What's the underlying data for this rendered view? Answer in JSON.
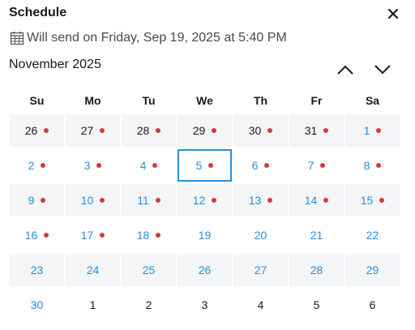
{
  "header": {
    "title": "Schedule",
    "send_text": "Will send on Friday, Sep 19, 2025 at 5:40 PM"
  },
  "calendar": {
    "month_label": "November 2025",
    "weekdays": [
      "Su",
      "Mo",
      "Tu",
      "We",
      "Th",
      "Fr",
      "Sa"
    ],
    "days": [
      {
        "label": "26",
        "month": "prev",
        "dot": true,
        "shaded": true
      },
      {
        "label": "27",
        "month": "prev",
        "dot": true,
        "shaded": true
      },
      {
        "label": "28",
        "month": "prev",
        "dot": true,
        "shaded": true
      },
      {
        "label": "29",
        "month": "prev",
        "dot": true,
        "shaded": true
      },
      {
        "label": "30",
        "month": "prev",
        "dot": true,
        "shaded": true
      },
      {
        "label": "31",
        "month": "prev",
        "dot": true,
        "shaded": true
      },
      {
        "label": "1",
        "month": "cur",
        "dot": true,
        "shaded": true
      },
      {
        "label": "2",
        "month": "cur",
        "dot": true,
        "shaded": false
      },
      {
        "label": "3",
        "month": "cur",
        "dot": true,
        "shaded": false
      },
      {
        "label": "4",
        "month": "cur",
        "dot": true,
        "shaded": false
      },
      {
        "label": "5",
        "month": "cur",
        "dot": true,
        "shaded": false,
        "selected": true
      },
      {
        "label": "6",
        "month": "cur",
        "dot": true,
        "shaded": false
      },
      {
        "label": "7",
        "month": "cur",
        "dot": true,
        "shaded": false
      },
      {
        "label": "8",
        "month": "cur",
        "dot": true,
        "shaded": false
      },
      {
        "label": "9",
        "month": "cur",
        "dot": true,
        "shaded": true
      },
      {
        "label": "10",
        "month": "cur",
        "dot": true,
        "shaded": true
      },
      {
        "label": "11",
        "month": "cur",
        "dot": true,
        "shaded": true
      },
      {
        "label": "12",
        "month": "cur",
        "dot": true,
        "shaded": true
      },
      {
        "label": "13",
        "month": "cur",
        "dot": true,
        "shaded": true
      },
      {
        "label": "14",
        "month": "cur",
        "dot": true,
        "shaded": true
      },
      {
        "label": "15",
        "month": "cur",
        "dot": true,
        "shaded": true
      },
      {
        "label": "16",
        "month": "cur",
        "dot": true,
        "shaded": false
      },
      {
        "label": "17",
        "month": "cur",
        "dot": true,
        "shaded": false
      },
      {
        "label": "18",
        "month": "cur",
        "dot": true,
        "shaded": false
      },
      {
        "label": "19",
        "month": "cur",
        "dot": false,
        "shaded": false
      },
      {
        "label": "20",
        "month": "cur",
        "dot": false,
        "shaded": false
      },
      {
        "label": "21",
        "month": "cur",
        "dot": false,
        "shaded": false
      },
      {
        "label": "22",
        "month": "cur",
        "dot": false,
        "shaded": false
      },
      {
        "label": "23",
        "month": "cur",
        "dot": false,
        "shaded": true
      },
      {
        "label": "24",
        "month": "cur",
        "dot": false,
        "shaded": true
      },
      {
        "label": "25",
        "month": "cur",
        "dot": false,
        "shaded": true
      },
      {
        "label": "26",
        "month": "cur",
        "dot": false,
        "shaded": true
      },
      {
        "label": "27",
        "month": "cur",
        "dot": false,
        "shaded": true
      },
      {
        "label": "28",
        "month": "cur",
        "dot": false,
        "shaded": true
      },
      {
        "label": "29",
        "month": "cur",
        "dot": false,
        "shaded": true
      },
      {
        "label": "30",
        "month": "cur",
        "dot": false,
        "shaded": false
      },
      {
        "label": "1",
        "month": "next",
        "dot": false,
        "shaded": false
      },
      {
        "label": "2",
        "month": "next",
        "dot": false,
        "shaded": false
      },
      {
        "label": "3",
        "month": "next",
        "dot": false,
        "shaded": false
      },
      {
        "label": "4",
        "month": "next",
        "dot": false,
        "shaded": false
      },
      {
        "label": "5",
        "month": "next",
        "dot": false,
        "shaded": false
      },
      {
        "label": "6",
        "month": "next",
        "dot": false,
        "shaded": false
      }
    ]
  },
  "icons": {
    "close": "close-icon",
    "calendar": "calendar-icon",
    "prev_month": "chevron-up-icon",
    "next_month": "chevron-down-icon"
  },
  "colors": {
    "accent": "#2b8ed6",
    "dot": "#d9393b",
    "shaded_row": "#f3f5f7"
  }
}
